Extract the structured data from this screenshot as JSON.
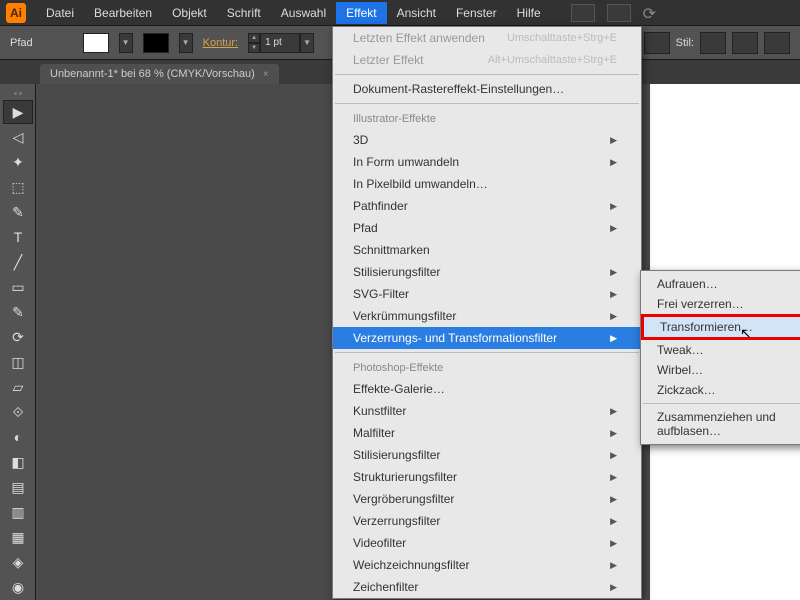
{
  "app": {
    "icon": "Ai"
  },
  "menubar": {
    "items": [
      "Datei",
      "Bearbeiten",
      "Objekt",
      "Schrift",
      "Auswahl",
      "Effekt",
      "Ansicht",
      "Fenster",
      "Hilfe"
    ],
    "open_index": 5
  },
  "controlbar": {
    "path_label": "Pfad",
    "kontur_label": "Kontur:",
    "stroke_value": "1 pt",
    "stil_label": "Stil:"
  },
  "tab": {
    "title": "Unbenannt-1* bei 68 % (CMYK/Vorschau)",
    "close": "×"
  },
  "tools": [
    "▶",
    "◁",
    "✦",
    "⬚",
    "✎",
    "T",
    "╱",
    "▭",
    "✎",
    "⟳",
    "◫",
    "▱",
    "⟐",
    "◐",
    "◧",
    "▤",
    "▥",
    "▦",
    "◈",
    "◉"
  ],
  "dropdown": {
    "apply_last": "Letzten Effekt anwenden",
    "apply_last_sc": "Umschalttaste+Strg+E",
    "last_effect": "Letzter Effekt",
    "last_effect_sc": "Alt+Umschalttaste+Strg+E",
    "raster_settings": "Dokument-Rastereffekt-Einstellungen…",
    "section_ai": "Illustrator-Effekte",
    "ai_items": [
      "3D",
      "In Form umwandeln",
      "In Pixelbild umwandeln…",
      "Pathfinder",
      "Pfad",
      "Schnittmarken",
      "Stilisierungsfilter",
      "SVG-Filter",
      "Verkrümmungsfilter",
      "Verzerrungs- und Transformationsfilter"
    ],
    "section_ps": "Photoshop-Effekte",
    "ps_items": [
      "Effekte-Galerie…",
      "Kunstfilter",
      "Malfilter",
      "Stilisierungsfilter",
      "Strukturierungsfilter",
      "Vergröberungsfilter",
      "Verzerrungsfilter",
      "Videofilter",
      "Weichzeichnungsfilter",
      "Zeichenfilter"
    ]
  },
  "submenu": {
    "items": [
      "Aufrauen…",
      "Frei verzerren…",
      "Transformieren…",
      "Tweak…",
      "Wirbel…",
      "Zickzack…"
    ],
    "sep_then": "Zusammenziehen und aufblasen…",
    "highlight_index": 2
  }
}
